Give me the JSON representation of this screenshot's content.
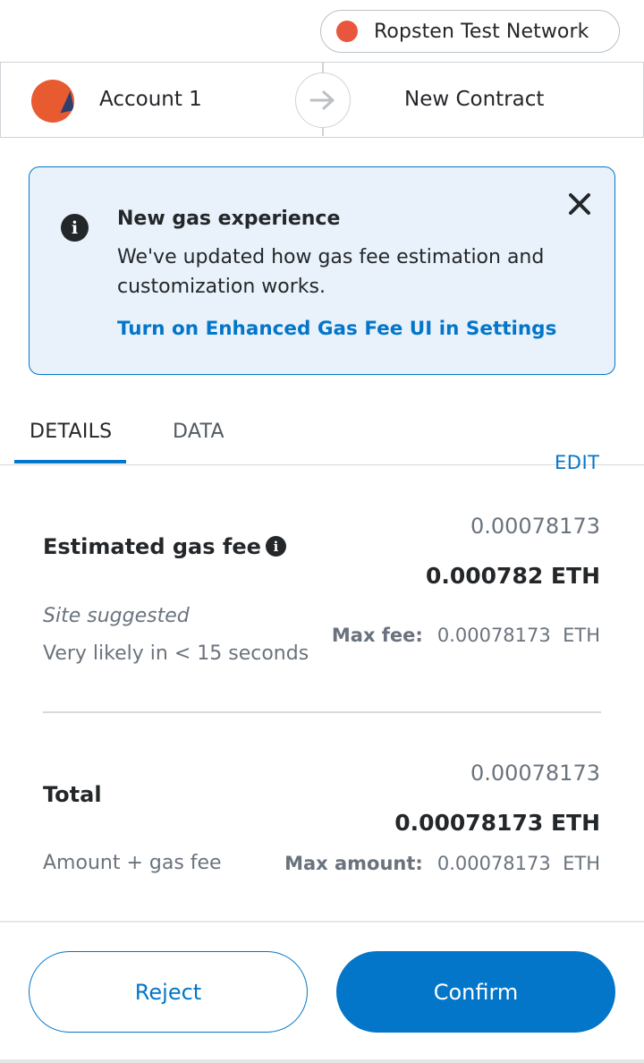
{
  "network": {
    "label": "Ropsten Test Network",
    "dot_color": "#e8573d"
  },
  "sender": {
    "account_name": "Account 1",
    "avatar": "account-identicon"
  },
  "recipient": {
    "label": "New Contract"
  },
  "banner": {
    "icon": "info-icon",
    "title": "New gas experience",
    "body": "We've updated how gas fee estimation and customization works.",
    "link": "Turn on Enhanced Gas Fee UI in Settings",
    "close_icon": "close-icon"
  },
  "tabs": [
    {
      "label": "DETAILS",
      "active": true
    },
    {
      "label": "DATA",
      "active": false
    }
  ],
  "gas": {
    "edit_label": "EDIT",
    "label": "Estimated gas fee",
    "value_fiat_like": "0.00078173",
    "value_eth": "0.000782 ETH",
    "site_suggested": "Site suggested",
    "likelihood": "Very likely in < 15 seconds",
    "max_fee_key": "Max fee:",
    "max_fee_value": "0.00078173  ETH"
  },
  "total": {
    "label": "Total",
    "value_light": "0.00078173",
    "value_eth": "0.00078173 ETH",
    "sub_label": "Amount + gas fee",
    "max_amount_key": "Max amount:",
    "max_amount_value": "0.00078173  ETH"
  },
  "buttons": {
    "reject": "Reject",
    "confirm": "Confirm"
  },
  "colors": {
    "accent": "#0376c9",
    "banner_bg": "#e9f2fb",
    "text": "#24272a",
    "muted": "#6a737d"
  }
}
